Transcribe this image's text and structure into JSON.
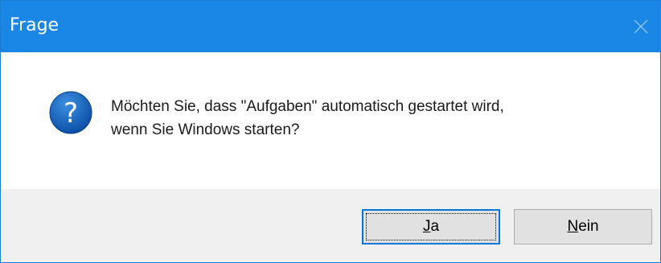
{
  "window": {
    "title": "Frage",
    "close_icon": "close-icon"
  },
  "message": {
    "icon": "question-icon",
    "line1": "Möchten Sie, dass \"Aufgaben\" automatisch gestartet wird,",
    "line2": "wenn Sie Windows starten?"
  },
  "buttons": {
    "yes": {
      "accel": "J",
      "rest": "a"
    },
    "no": {
      "accel": "N",
      "rest": "ein"
    }
  },
  "colors": {
    "titlebar": "#1a86e6",
    "icon_blue": "#1564c0",
    "footer": "#f0f0f0"
  }
}
